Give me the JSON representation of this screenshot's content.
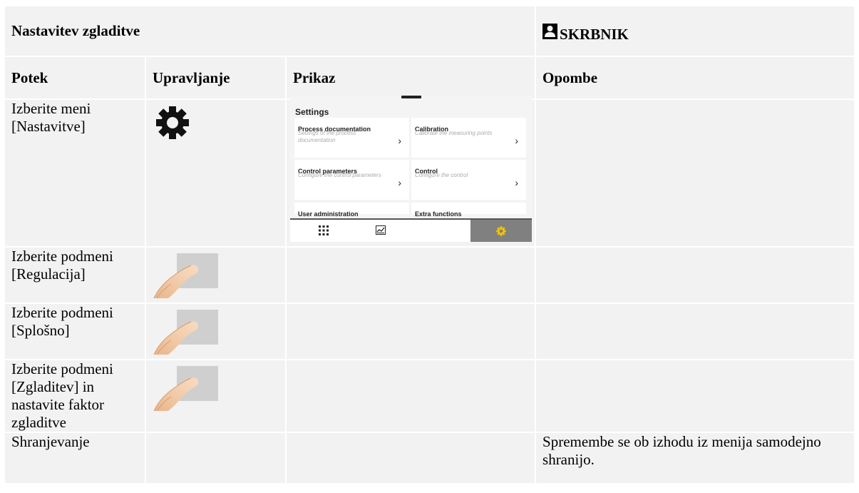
{
  "header": {
    "title": "Nastavitev zgladitve",
    "role": "SKRBNIK",
    "role_icon": "person-icon"
  },
  "columns": [
    "Potek",
    "Upravljanje",
    "Prikaz",
    "Opombe"
  ],
  "rows": [
    {
      "step": "Izberite meni [Nastavitve]",
      "control_icon": "gear-icon",
      "note": ""
    },
    {
      "step": "Izberite podmeni [Regulacija]",
      "control_icon": "touch-finger-icon",
      "note": ""
    },
    {
      "step": "Izberite podmeni [Splošno]",
      "control_icon": "touch-finger-icon",
      "note": ""
    },
    {
      "step": "Izberite podmeni [Zgladitev] in nastavite faktor zgladitve",
      "control_icon": "touch-finger-icon",
      "note": ""
    },
    {
      "step": "Shranjevanje",
      "control_icon": "",
      "note": "Spremembe se ob izhodu iz menija samodejno shranijo."
    }
  ],
  "screen": {
    "title": "Settings",
    "tiles": [
      {
        "title": "Process documentation",
        "subtitle": "Settings of the process documentation"
      },
      {
        "title": "Calibration",
        "subtitle": "Calibrate the measuring points"
      },
      {
        "title": "Control parameters",
        "subtitle": "Configure the control parameters"
      },
      {
        "title": "Control",
        "subtitle": "Configure the control"
      },
      {
        "title": "User administration",
        "subtitle": ""
      },
      {
        "title": "Extra functions",
        "subtitle": ""
      }
    ],
    "nav": [
      "grid-icon",
      "chart-icon",
      "gear-icon"
    ],
    "accent_color": "#f2c500"
  }
}
